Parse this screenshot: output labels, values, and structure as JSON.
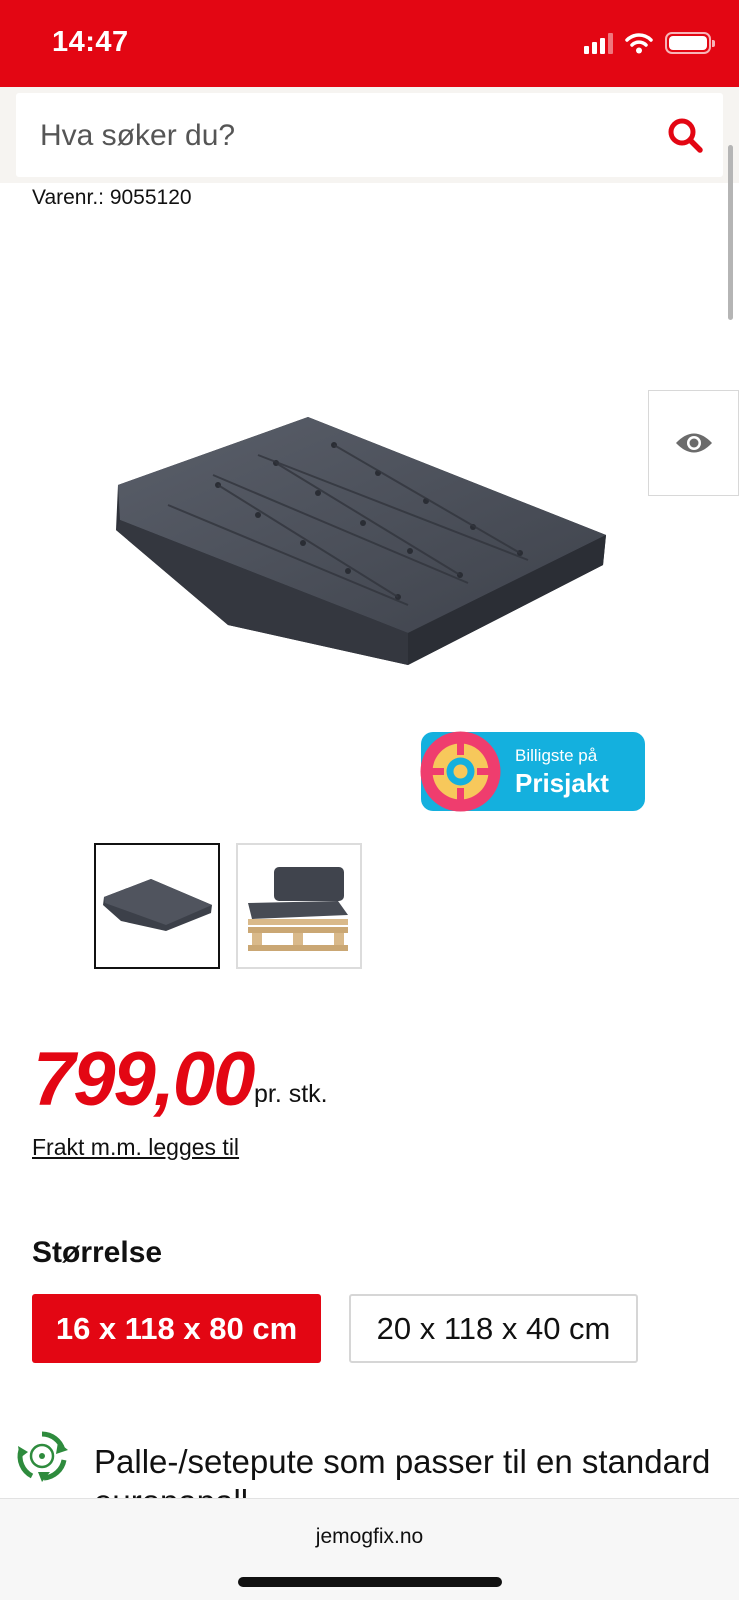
{
  "status_bar": {
    "time": "14:47",
    "icons": [
      "signal-icon",
      "wifi-icon",
      "battery-icon"
    ]
  },
  "search": {
    "placeholder": "Hva søker du?",
    "icon": "search-icon"
  },
  "product": {
    "sku": "Varenr.: 9055120",
    "image_alt": "Dark grey pallet seat cushion",
    "view_icon": "eye-icon",
    "prisjakt_badge": {
      "line1": "Billigste på",
      "line2": "Prisjakt"
    },
    "thumbnails": [
      {
        "alt": "Cushion product photo",
        "selected": true
      },
      {
        "alt": "Cushion on wooden pallet",
        "selected": false
      }
    ],
    "price": "799,00",
    "price_unit": "pr. stk.",
    "shipping_link": "Frakt m.m. legges til",
    "size_heading": "Størrelse",
    "sizes": [
      {
        "label": "16 x 118 x 80 cm",
        "selected": true
      },
      {
        "label": "20 x 118 x 40 cm",
        "selected": false
      }
    ],
    "feature": {
      "icon": "recycle-icon",
      "text": "Palle-/setepute som passer til en standard europapall"
    }
  },
  "browser": {
    "url": "jemogfix.no"
  },
  "colors": {
    "brand_red": "#e30613",
    "prisjakt_blue": "#14b0de"
  }
}
